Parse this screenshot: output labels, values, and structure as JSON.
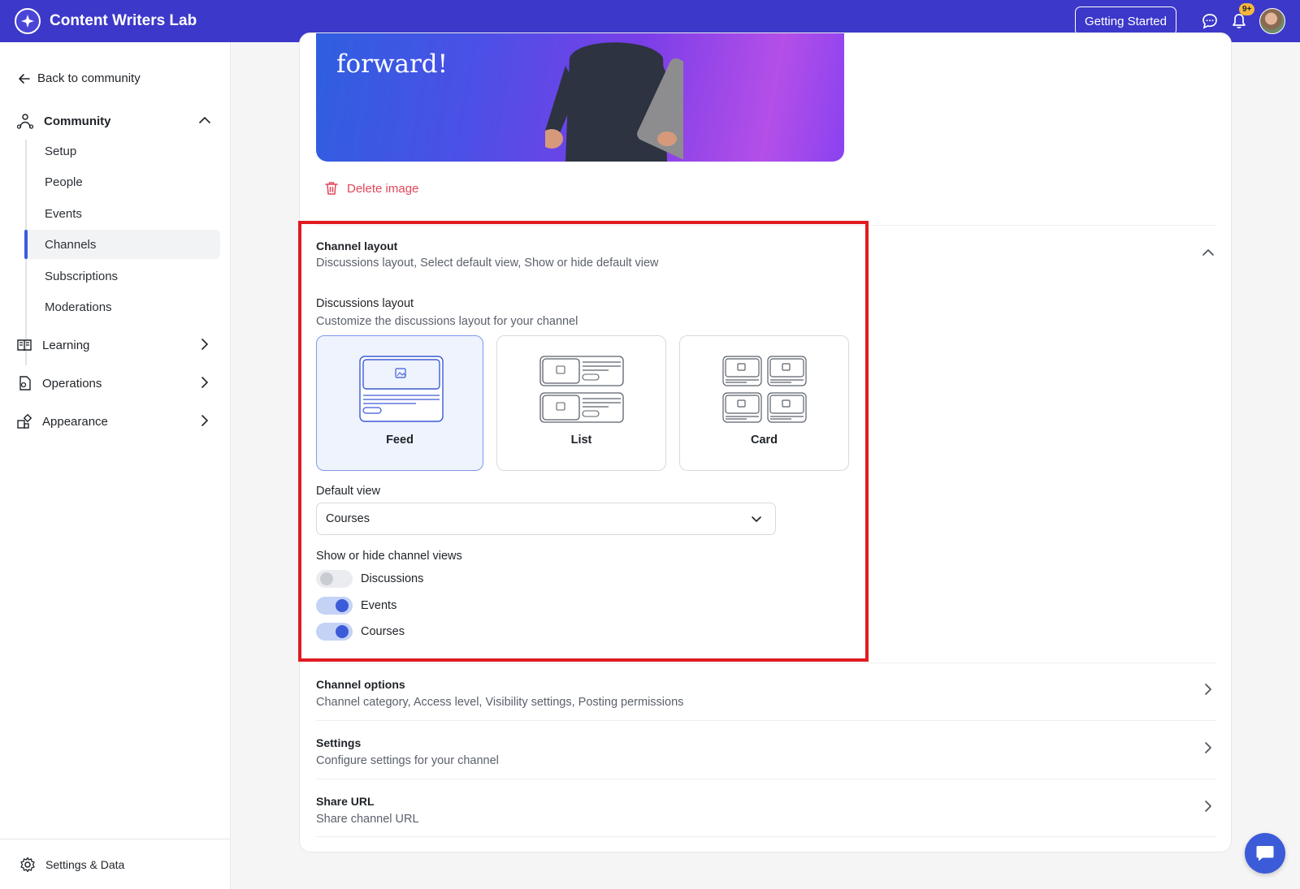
{
  "app": {
    "title": "Content Writers Lab"
  },
  "topbar": {
    "getting_started": "Getting Started",
    "notification_badge": "9+",
    "icons": [
      "chat-icon",
      "bell-icon"
    ]
  },
  "sidebar": {
    "back_label": "Back to community",
    "community": {
      "label": "Community",
      "items": [
        "Setup",
        "People",
        "Events",
        "Channels",
        "Subscriptions",
        "Moderations"
      ],
      "active": "Channels"
    },
    "sections": [
      {
        "label": "Learning",
        "icon": "book-icon"
      },
      {
        "label": "Operations",
        "icon": "operations-icon"
      },
      {
        "label": "Appearance",
        "icon": "appearance-icon"
      }
    ],
    "footer": "Settings & Data"
  },
  "banner": {
    "text": "forward!"
  },
  "delete_image": "Delete image",
  "channel_layout": {
    "title": "Channel layout",
    "subtitle": "Discussions layout, Select default view, Show or hide default view",
    "discussions_layout": {
      "title": "Discussions layout",
      "subtitle": "Customize the discussions layout for your channel"
    },
    "options": [
      "Feed",
      "List",
      "Card"
    ],
    "selected": "Feed",
    "default_view": {
      "label": "Default view",
      "value": "Courses"
    },
    "views": {
      "label": "Show or hide channel views",
      "items": [
        {
          "label": "Discussions",
          "enabled": false
        },
        {
          "label": "Events",
          "enabled": true
        },
        {
          "label": "Courses",
          "enabled": true
        }
      ]
    }
  },
  "sections": [
    {
      "title": "Channel options",
      "subtitle": "Channel category, Access level, Visibility settings, Posting permissions"
    },
    {
      "title": "Settings",
      "subtitle": "Configure settings for your channel"
    },
    {
      "title": "Share URL",
      "subtitle": "Share channel URL"
    }
  ],
  "colors": {
    "brand": "#3c38c9",
    "accent": "#3c5bd8",
    "danger": "#e0465a",
    "highlight": "#e01b22"
  }
}
